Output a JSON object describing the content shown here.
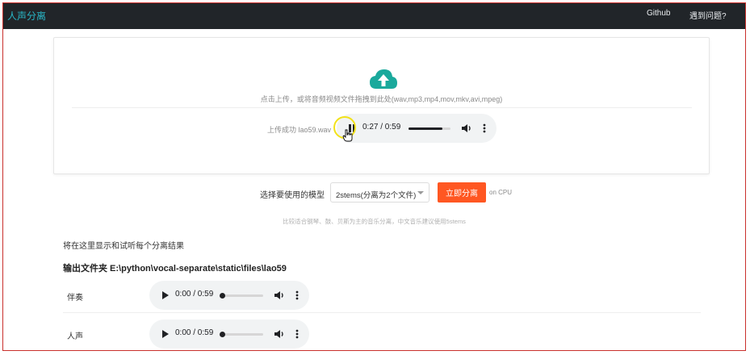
{
  "navbar": {
    "brand": "人声分离",
    "links": [
      "Github",
      "遇到问题?"
    ]
  },
  "upload": {
    "icon": "cloud-upload-icon",
    "hint": "点击上传，或将音频视频文件拖拽到此处(wav,mp3,mp4,mov,mkv,avi,mpeg)",
    "status": "上传成功 lao59.wav",
    "player": {
      "time": "0:27 / 0:59",
      "progress": 0.81,
      "state": "playing"
    }
  },
  "model": {
    "label": "选择要使用的模型",
    "selected": "2stems(分离为2个文件)",
    "button": "立即分离",
    "device": "on CPU",
    "hint": "比较适合钢琴、鼓、贝斯为主的音乐分离，中文音乐建议使用5stems"
  },
  "results": {
    "note": "将在这里显示和试听每个分离结果",
    "folder": "输出文件夹 E:\\python\\vocal-separate\\static\\files\\lao59",
    "tracks": [
      {
        "label": "伴奏",
        "time": "0:00 / 0:59",
        "progress": 0
      },
      {
        "label": "人声",
        "time": "0:00 / 0:59",
        "progress": 0
      }
    ]
  },
  "colors": {
    "navbar": "#212529",
    "brand": "#29b7c7",
    "accent_button": "#ff5722",
    "player_bg": "#f1f3f4"
  }
}
